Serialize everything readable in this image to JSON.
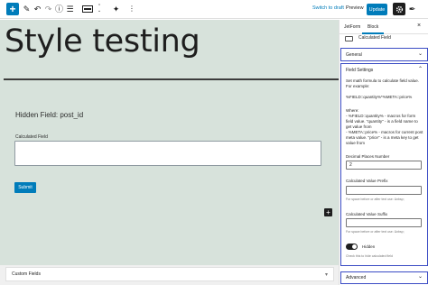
{
  "toolbar": {
    "add_icon": "+",
    "switch_to_draft": "Switch to draft",
    "preview": "Preview",
    "update": "Update"
  },
  "canvas": {
    "title": "Style testing",
    "hidden_field_text": "Hidden Field: post_id",
    "calculated_field_label": "Calculated Field",
    "submit_label": "Submit"
  },
  "meta": {
    "custom_fields_label": "Custom Fields"
  },
  "sidebar": {
    "tabs": [
      "JetForm",
      "Block"
    ],
    "active_tab": "Block",
    "block_name": "Calculated Field",
    "general_label": "General",
    "field_settings": {
      "title": "Field Settings",
      "intro": "Set math formula to calculate field value. For example:",
      "example": "%FIELD::quantity%*%META::price%",
      "where": "Where:",
      "line1": "- %FIELD::quantity% - macros for form field value. \"quantity\" - is a field name to get value from",
      "line2": "- %META::price% - macros for current post meta value. \"price\" - is a meta key to get value from",
      "decimal_label": "Decimal Places Number",
      "decimal_value": "2",
      "prefix_label": "Calculated Value Prefix",
      "prefix_help": "For space before or after text use: &nbsp;",
      "suffix_label": "Calculated Value Suffix",
      "suffix_help": "For space before or after text use: &nbsp;",
      "hidden_label": "Hidden",
      "hidden_help": "Check this to hide calculated field"
    },
    "advanced_label": "Advanced"
  },
  "colors": {
    "accent": "#007cba",
    "canvas_bg": "#d7e2db",
    "highlight_border": "#3a4bc4"
  }
}
